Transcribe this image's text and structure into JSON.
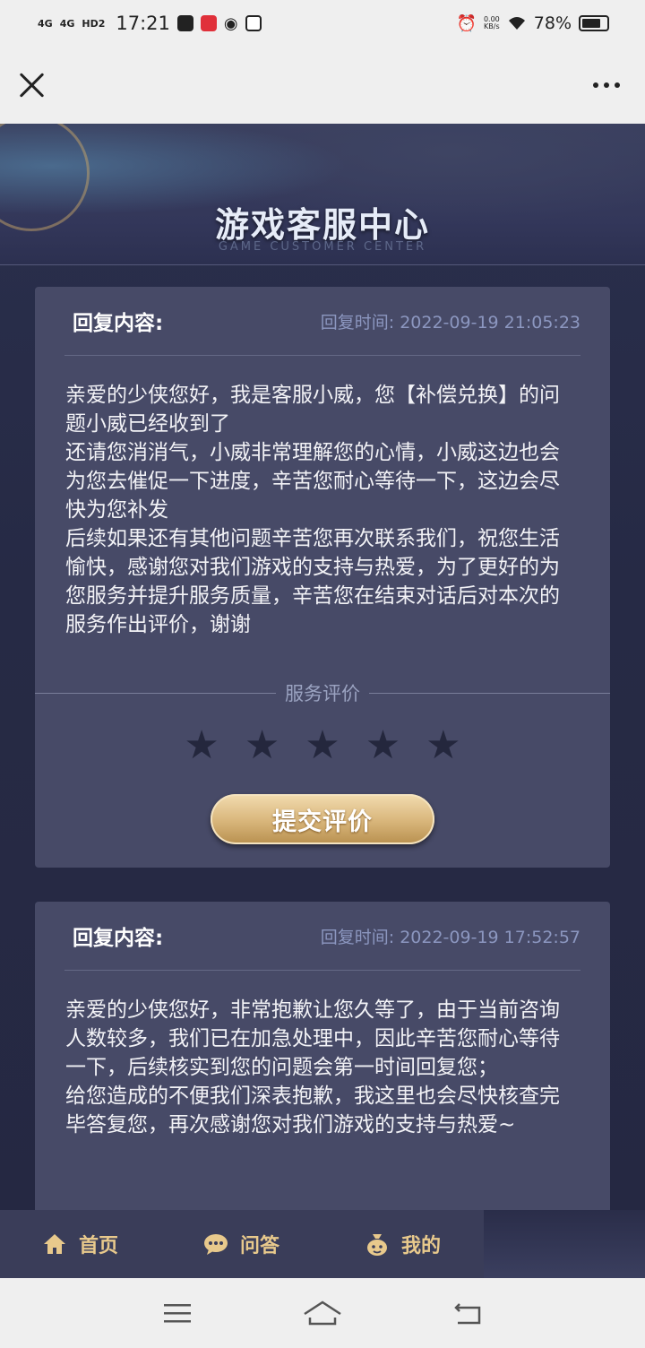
{
  "status_bar": {
    "signal_1": "4G",
    "signal_2": "4G",
    "hd_label": "HD2",
    "time": "17:21",
    "net_speed_value": "0.00",
    "net_speed_unit": "KB/s",
    "battery_percent": "78%",
    "battery_level": 0.78
  },
  "title_bar": {
    "close_icon": "close-icon",
    "more_icon": "more-icon"
  },
  "banner": {
    "title": "游戏客服中心",
    "subtitle": "GAME CUSTOMER CENTER"
  },
  "replies": [
    {
      "label": "回复内容:",
      "time": "回复时间: 2022-09-19 21:05:23",
      "paragraphs": [
        "亲爱的少侠您好，我是客服小威，您【补偿兑换】的问题小威已经收到了",
        "还请您消消气，小威非常理解您的心情，小威这边也会为您去催促一下进度，辛苦您耐心等待一下，这边会尽快为您补发",
        "后续如果还有其他问题辛苦您再次联系我们，祝您生活愉快，感谢您对我们游戏的支持与热爱，为了更好的为您服务并提升服务质量，辛苦您在结束对话后对本次的服务作出评价，谢谢"
      ],
      "rating_label": "服务评价",
      "rating_value": 0,
      "rating_max": 5,
      "submit_label": "提交评价"
    },
    {
      "label": "回复内容:",
      "time": "回复时间: 2022-09-19 17:52:57",
      "paragraphs": [
        "亲爱的少侠您好，非常抱歉让您久等了，由于当前咨询人数较多，我们已在加急处理中，因此辛苦您耐心等待一下，后续核实到您的问题会第一时间回复您；",
        "给您造成的不便我们深表抱歉，我这里也会尽快核查完毕答复您，再次感谢您对我们游戏的支持与热爱~"
      ]
    }
  ],
  "bottom_nav": {
    "items": [
      {
        "label": "首页",
        "icon": "home-icon"
      },
      {
        "label": "问答",
        "icon": "chat-icon"
      },
      {
        "label": "我的",
        "icon": "user-bag-icon"
      }
    ]
  },
  "colors": {
    "accent_gold": "#e8c98c",
    "card_bg": "#474a67",
    "page_bg": "#262a45",
    "time_text": "#8c97c0"
  }
}
